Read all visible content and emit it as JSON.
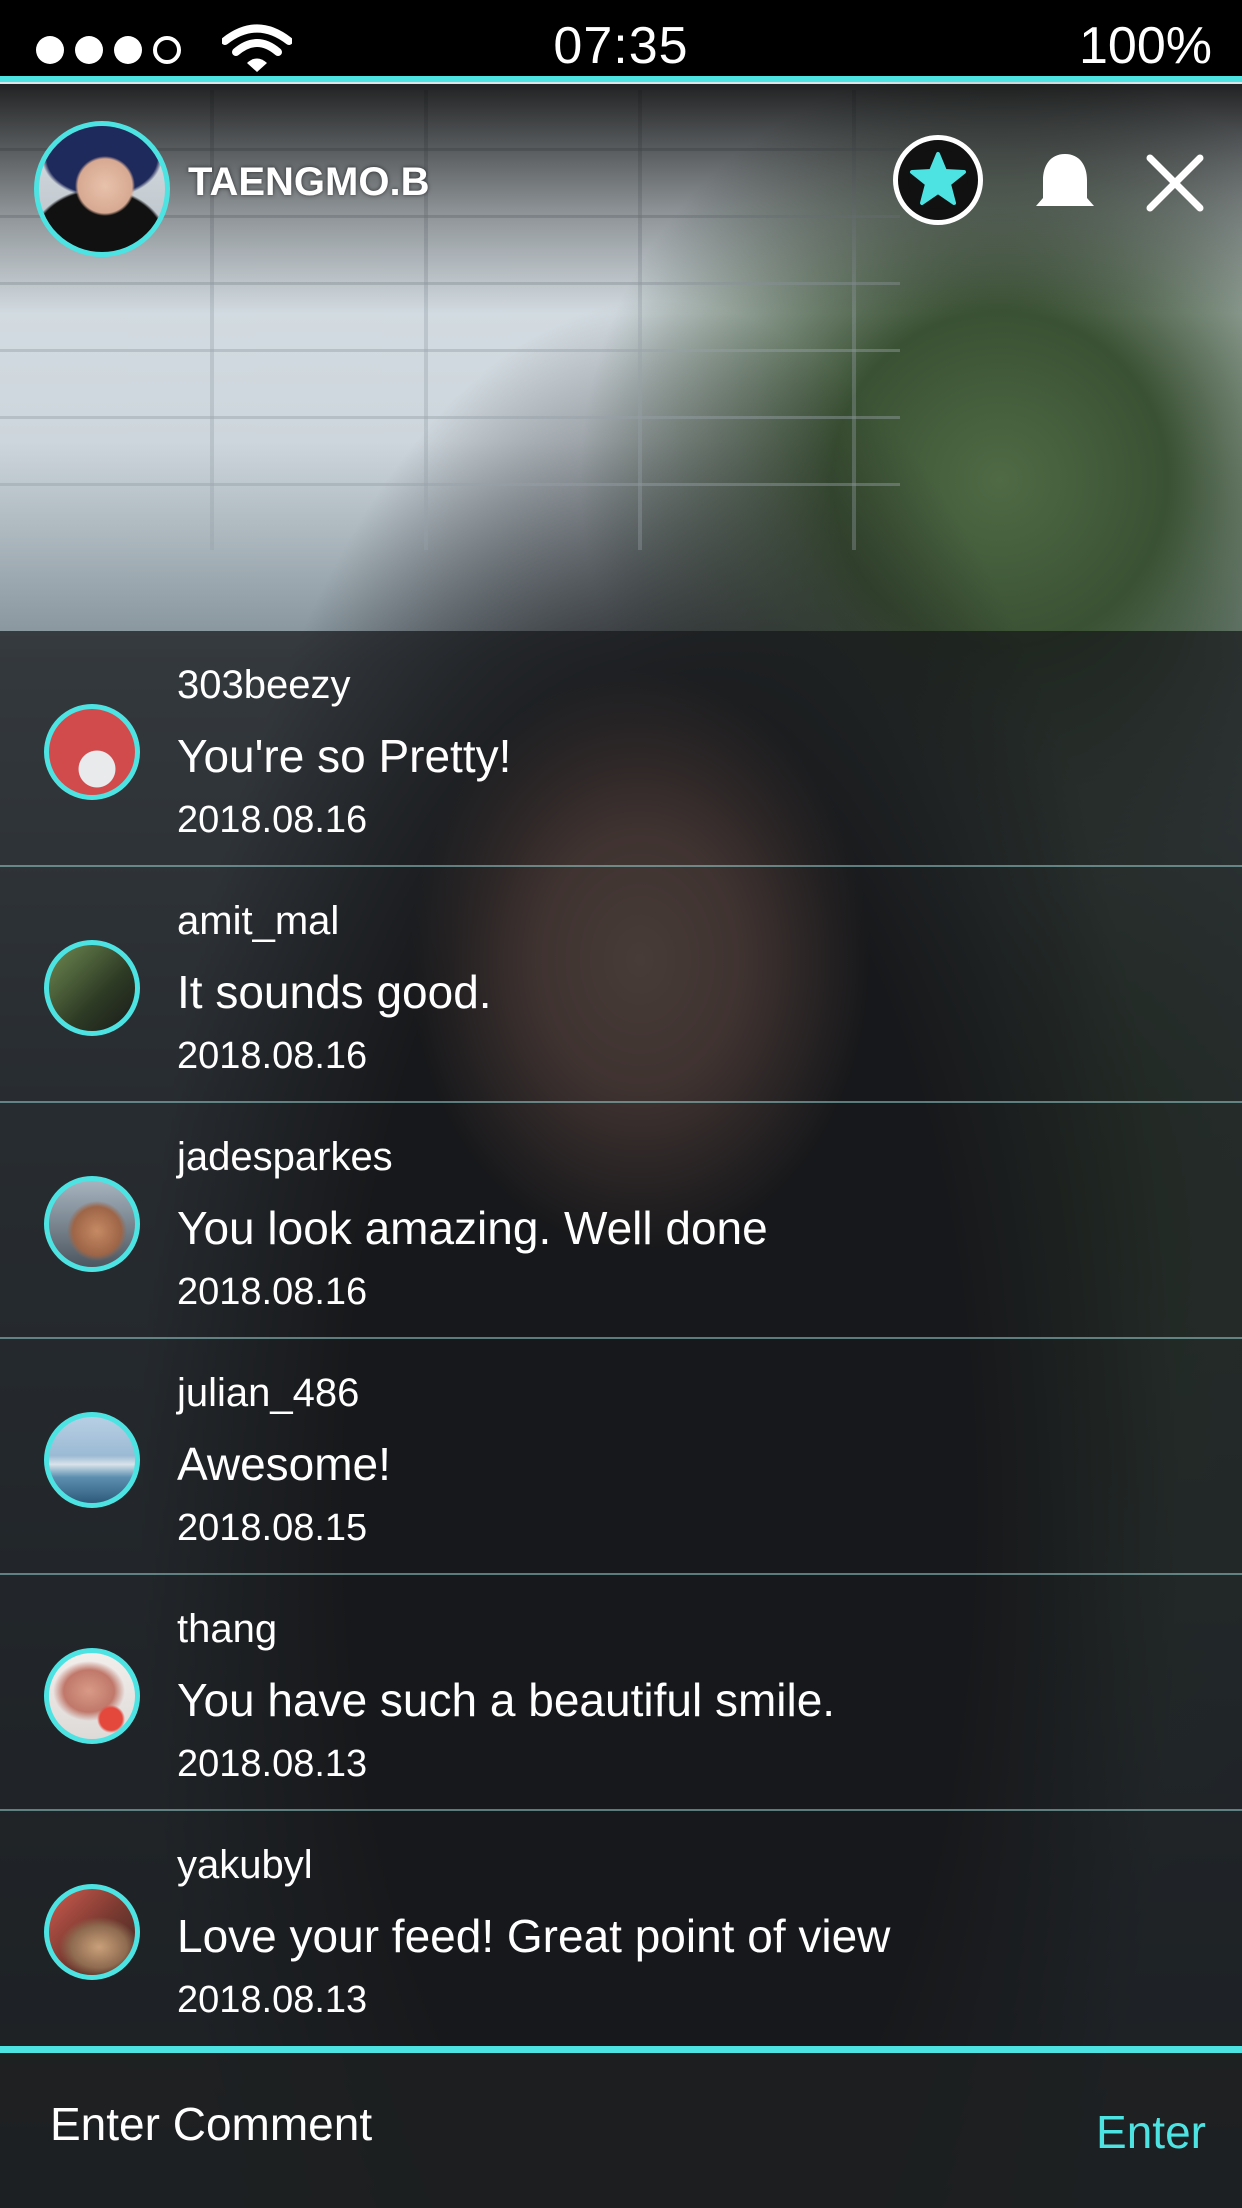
{
  "status_bar": {
    "time": "07:35",
    "battery": "100%"
  },
  "header": {
    "username": "TAENGMO.B",
    "accent_color": "#4ee3e3"
  },
  "comments": [
    {
      "user": "303beezy",
      "text": "You're so Pretty!",
      "date": "2018.08.16"
    },
    {
      "user": "amit_mal",
      "text": "It sounds good.",
      "date": "2018.08.16"
    },
    {
      "user": "jadesparkes",
      "text": "You look amazing. Well done",
      "date": "2018.08.16"
    },
    {
      "user": "julian_486",
      "text": "Awesome!",
      "date": "2018.08.15"
    },
    {
      "user": "thang",
      "text": "You have such a beautiful smile.",
      "date": "2018.08.13"
    },
    {
      "user": "yakubyl",
      "text": "Love your feed! Great point of view",
      "date": "2018.08.13"
    }
  ],
  "input": {
    "placeholder": "Enter Comment",
    "submit_label": "Enter"
  }
}
